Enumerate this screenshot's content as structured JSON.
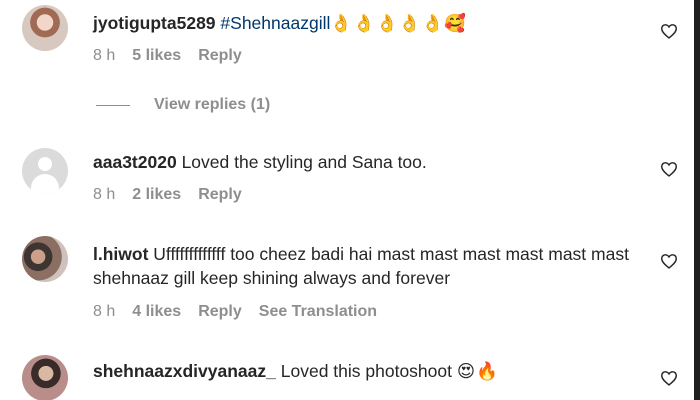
{
  "comments": [
    {
      "username": "jyotigupta5289",
      "hashtag": "#Shehnaazgill",
      "text": "",
      "emoji": "👌👌👌👌👌🥰",
      "time": "8 h",
      "likes": "5 likes",
      "reply": "Reply"
    },
    {
      "username": "aaa3t2020",
      "text": "Loved the styling and Sana too.",
      "time": "8 h",
      "likes": "2 likes",
      "reply": "Reply"
    },
    {
      "username": "l.hiwot",
      "text": "Ufffffffffffff too cheez badi hai mast mast mast mast mast mast shehnaaz gill keep shining always and forever",
      "time": "8 h",
      "likes": "4 likes",
      "reply": "Reply",
      "translate": "See Translation"
    },
    {
      "username": "shehnaazxdivyanaaz_",
      "text": "Loved this photoshoot",
      "emoji": "😍🔥"
    }
  ],
  "view_replies": "View replies (1)",
  "icons": {
    "like": "heart-icon",
    "avatar_default": "user-silhouette-icon"
  },
  "colors": {
    "text": "#262626",
    "muted": "#8e8e8e",
    "hashtag": "#00376b"
  }
}
